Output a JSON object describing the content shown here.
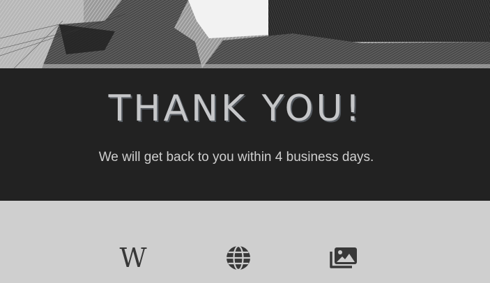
{
  "thanks": {
    "title": "THANK YOU!",
    "subtitle": "We will get back to you within 4 business days."
  },
  "footer": {
    "icons": [
      {
        "name": "wikipedia-icon",
        "glyph": "W"
      },
      {
        "name": "globe-icon"
      },
      {
        "name": "image-gallery-icon"
      }
    ]
  },
  "colors": {
    "dark_band": "#222222",
    "light_band": "#cfcfcf",
    "title_text": "#c6c7c9",
    "icon": "#383838"
  }
}
